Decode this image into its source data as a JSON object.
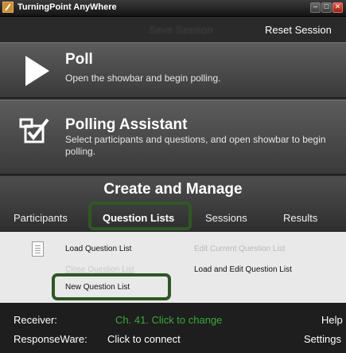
{
  "window": {
    "title": "TurningPoint AnyWhere"
  },
  "session": {
    "save_label": "Save Session",
    "reset_label": "Reset Session"
  },
  "poll": {
    "title": "Poll",
    "description": "Open the showbar and begin polling."
  },
  "assistant": {
    "title": "Polling Assistant",
    "description": "Select participants and questions, and open showbar to begin polling."
  },
  "manage": {
    "title": "Create and Manage",
    "tabs": [
      {
        "label": "Participants"
      },
      {
        "label": "Question Lists",
        "active": true
      },
      {
        "label": "Sessions"
      },
      {
        "label": "Results"
      }
    ]
  },
  "question_lists": {
    "load": "Load Question List",
    "close": "Close Question List",
    "new": "New Question List",
    "edit_current": "Edit Current Question List",
    "load_edit": "Load and Edit Question List"
  },
  "footer": {
    "receiver_label": "Receiver:",
    "receiver_status": "Ch. 41. Click to change",
    "help": "Help",
    "responseware_label": "ResponseWare:",
    "responseware_status": "Click to connect",
    "settings": "Settings"
  },
  "colors": {
    "highlight": "#2b5a22",
    "status_green": "#34ad33"
  },
  "icons": [
    "app-logo-icon",
    "minimize-icon",
    "maximize-icon",
    "close-icon",
    "play-icon",
    "polling-assistant-icon",
    "document-icon"
  ]
}
